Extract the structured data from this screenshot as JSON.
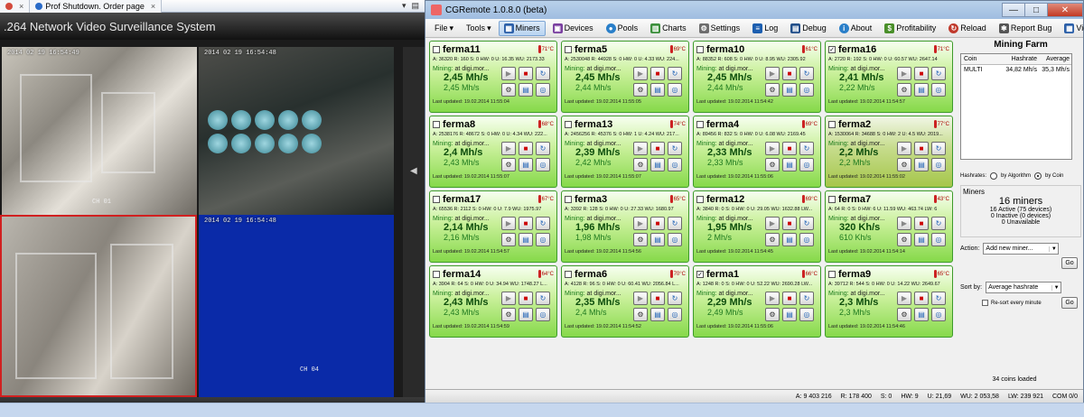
{
  "browser": {
    "tabs": [
      {
        "label": "",
        "color": "#d34a3c"
      },
      {
        "label": "Prof Shutdown. Order page",
        "color": "#2a6bc8"
      }
    ]
  },
  "dvr": {
    "title": ".264 Network Video Surveillance System",
    "feeds": [
      {
        "timestamp": "2014 02 19 16:54:49",
        "channel": "CH 01"
      },
      {
        "timestamp": "2014 02 19 16:54:48",
        "channel": ""
      },
      {
        "timestamp": "",
        "channel": ""
      },
      {
        "timestamp": "2014 02 19 16:54:48",
        "channel": "CH 04"
      }
    ]
  },
  "app": {
    "title": "CGRemote 1.0.8.0 (beta)",
    "win_min": "—",
    "win_max": "□",
    "win_close": "✕"
  },
  "toolbar": {
    "file": "File",
    "tools": "Tools",
    "miners": "Miners",
    "devices": "Devices",
    "pools": "Pools",
    "charts": "Charts",
    "settings": "Settings",
    "log": "Log",
    "debug": "Debug",
    "about": "About",
    "profitability": "Profitability",
    "reload": "Reload",
    "report_bug": "Report Bug",
    "view": "View"
  },
  "miners": [
    {
      "name": "ferma11",
      "checked": false,
      "temp": "71°C",
      "stats": "A: 36320 R: 160 S: 0 HW: 0 U: 16.35 WU: 2173.33",
      "pool": "at digi.mor...",
      "rate": "2,45 Mh/s",
      "avg": "2,45 Mh/s",
      "updated": "Last updated: 19.02.2014 11:55:04",
      "dim": false
    },
    {
      "name": "ferma5",
      "checked": false,
      "temp": "69°C",
      "stats": "A: 2530048 R: 44928 S: 0 HW: 0 U: 4.33 WU: 224...",
      "pool": "at digi.mor...",
      "rate": "2,45 Mh/s",
      "avg": "2,44 Mh/s",
      "updated": "Last updated: 19.02.2014 11:55:05",
      "dim": false
    },
    {
      "name": "ferma10",
      "checked": false,
      "temp": "61°C",
      "stats": "A: 88352 R: 608 S: 0 HW: 0 U: 8.95 WU: 2305.92",
      "pool": "at digi.mor...",
      "rate": "2,45 Mh/s",
      "avg": "2,44 Mh/s",
      "updated": "Last updated: 19.02.2014 11:54:42",
      "dim": false
    },
    {
      "name": "ferma16",
      "checked": true,
      "temp": "71°C",
      "stats": "A: 2720 R: 192 S: 0 HW: 0 U: 60.57 WU: 2647.14",
      "pool": "at digi.mor...",
      "rate": "2,41 Mh/s",
      "avg": "2,22 Mh/s",
      "updated": "Last updated: 19.02.2014 11:54:57",
      "dim": false
    },
    {
      "name": "ferma8",
      "checked": false,
      "temp": "68°C",
      "stats": "A: 2538176 R: 48672 S: 0 HW: 0 U: 4.34 WU: 222...",
      "pool": "at digi.mor...",
      "rate": "2,4 Mh/s",
      "avg": "2,43 Mh/s",
      "updated": "Last updated: 19.02.2014 11:55:07",
      "dim": false
    },
    {
      "name": "ferma13",
      "checked": false,
      "temp": "74°C",
      "stats": "A: 2456256 R: 45376 S: 0 HW: 1 U: 4.24 WU: 217...",
      "pool": "at digi.mor...",
      "rate": "2,39 Mh/s",
      "avg": "2,42 Mh/s",
      "updated": "Last updated: 19.02.2014 11:55:07",
      "dim": false
    },
    {
      "name": "ferma4",
      "checked": false,
      "temp": "69°C",
      "stats": "A: 89456 R: 832 S: 0 HW: 0 U: 6.08 WU: 2169.45",
      "pool": "at digi.mor...",
      "rate": "2,33 Mh/s",
      "avg": "2,33 Mh/s",
      "updated": "Last updated: 19.02.2014 11:55:06",
      "dim": false
    },
    {
      "name": "ferma2",
      "checked": false,
      "temp": "77°C",
      "stats": "A: 1530064 R: 34688 S: 0 HW: 2 U: 4.5 WU: 2019...",
      "pool": "at digi.mor...",
      "rate": "2,2 Mh/s",
      "avg": "2,2 Mh/s",
      "updated": "Last updated: 19.02.2014 11:55:02",
      "dim": true
    },
    {
      "name": "ferma17",
      "checked": false,
      "temp": "67°C",
      "stats": "A: 65536 R: 2112 S: 0 HW: 0 U: 7.9 WU: 1975.97",
      "pool": "at digi.mor...",
      "rate": "2,14 Mh/s",
      "avg": "2,16 Mh/s",
      "updated": "Last updated: 19.02.2014 11:54:57",
      "dim": false
    },
    {
      "name": "ferma3",
      "checked": false,
      "temp": "65°C",
      "stats": "A: 3392 R: 128 S: 0 HW: 0 U: 27.33 WU: 1680.97",
      "pool": "at digi.mor...",
      "rate": "1,96 Mh/s",
      "avg": "1,98 Mh/s",
      "updated": "Last updated: 19.02.2014 11:54:56",
      "dim": false
    },
    {
      "name": "ferma12",
      "checked": false,
      "temp": "69°C",
      "stats": "A: 3840 R: 0 S: 0 HW: 0 U: 29.05 WU: 1632.88 LW...",
      "pool": "at digi.mor...",
      "rate": "1,95 Mh/s",
      "avg": "2 Mh/s",
      "updated": "Last updated: 19.02.2014 11:54:45",
      "dim": false
    },
    {
      "name": "ferma7",
      "checked": false,
      "temp": "43°C",
      "stats": "A: 64 R: 0 S: 0 HW: 6 U: 11.59 WU: 463.74 LW: 6",
      "pool": "at digi.mor...",
      "rate": "320 Kh/s",
      "avg": "610 Kh/s",
      "updated": "Last updated: 19.02.2014 11:54:14",
      "dim": false
    },
    {
      "name": "ferma14",
      "checked": false,
      "temp": "64°C",
      "stats": "A: 3904 R: 64 S: 0 HW: 0 U: 34.94 WU: 1748.27 L...",
      "pool": "at digi.mor...",
      "rate": "2,43 Mh/s",
      "avg": "2,43 Mh/s",
      "updated": "Last updated: 19.02.2014 11:54:59",
      "dim": false
    },
    {
      "name": "ferma6",
      "checked": false,
      "temp": "70°C",
      "stats": "A: 4128 R: 96 S: 0 HW: 0 U: 60.41 WU: 2056.84 L...",
      "pool": "at digi.mor...",
      "rate": "2,35 Mh/s",
      "avg": "2,4 Mh/s",
      "updated": "Last updated: 19.02.2014 11:54:52",
      "dim": false
    },
    {
      "name": "ferma1",
      "checked": true,
      "temp": "66°C",
      "stats": "A: 1248 R: 0 S: 0 HW: 0 U: 52.22 WU: 2690.28 LW...",
      "pool": "at digi.mor...",
      "rate": "2,29 Mh/s",
      "avg": "2,49 Mh/s",
      "updated": "Last updated: 19.02.2014 11:55:06",
      "dim": false
    },
    {
      "name": "ferma9",
      "checked": false,
      "temp": "65°C",
      "stats": "A: 39712 R: 544 S: 0 HW: 0 U: 14.22 WU: 2649.67",
      "pool": "at digi.mor...",
      "rate": "2,3 Mh/s",
      "avg": "2,3 Mh/s",
      "updated": "Last updated: 19.02.2014 11:54:46",
      "dim": false
    }
  ],
  "card_labels": {
    "mining": "Mining:"
  },
  "panel": {
    "title": "Mining Farm",
    "col_coin": "Coin",
    "col_hashrate": "Hashrate",
    "col_average": "Average",
    "rows": [
      {
        "coin": "MULTI",
        "hashrate": "34,82 Mh/s",
        "average": "35,3 Mh/s"
      }
    ],
    "hashrates_label": "Hashrates:",
    "by_algorithm": "by Algorithm",
    "by_coin": "by Coin",
    "miners_label": "Miners",
    "miners_count": "16 miners",
    "active": "16 Active  (75 devices)",
    "inactive": "0 Inactive  (0 devices)",
    "unavailable": "0 Unavailable",
    "action_label": "Action:",
    "action_value": "Add new miner...",
    "go1": "Go",
    "sort_label": "Sort by:",
    "sort_value": "Average hashrate",
    "resort_label": "Re-sort every minute",
    "go2": "Go",
    "coins_loaded": "34 coins loaded"
  },
  "status": {
    "a": "A: 9 403 216",
    "r": "R: 178 400",
    "s": "S: 0",
    "hw": "HW: 9",
    "u": "U: 21,69",
    "wu": "WU: 2 053,58",
    "lw": "LW: 239 921",
    "com": "COM 0/0"
  }
}
